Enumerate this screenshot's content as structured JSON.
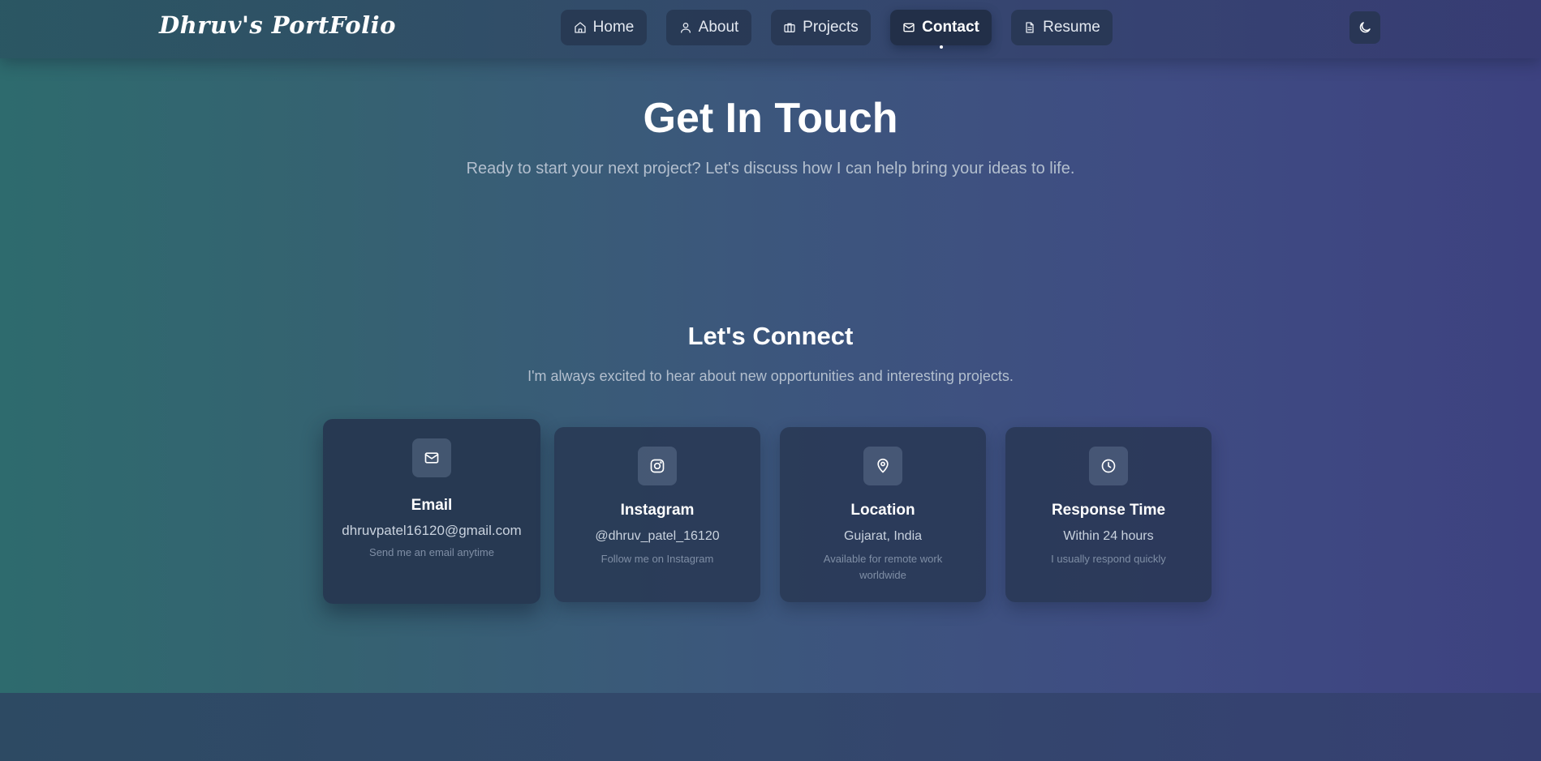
{
  "header": {
    "brand": "Dhruv's PortFolio",
    "nav": [
      {
        "label": "Home",
        "icon": "home-icon"
      },
      {
        "label": "About",
        "icon": "user-icon"
      },
      {
        "label": "Projects",
        "icon": "briefcase-icon"
      },
      {
        "label": "Contact",
        "icon": "mail-icon",
        "active": true
      },
      {
        "label": "Resume",
        "icon": "file-text-icon"
      }
    ],
    "theme_toggle_icon": "moon-icon"
  },
  "hero": {
    "title": "Get In Touch",
    "subtitle": "Ready to start your next project? Let's discuss how I can help bring your ideas to life."
  },
  "connect": {
    "title": "Let's Connect",
    "subtitle": "I'm always excited to hear about new opportunities and interesting projects.",
    "cards": [
      {
        "title": "Email",
        "value": "dhruvpatel16120@gmail.com",
        "note": "Send me an email anytime",
        "icon": "mail-icon"
      },
      {
        "title": "Instagram",
        "value": "@dhruv_patel_16120",
        "note": "Follow me on Instagram",
        "icon": "instagram-icon"
      },
      {
        "title": "Location",
        "value": "Gujarat, India",
        "note": "Available for remote work worldwide",
        "icon": "map-pin-icon"
      },
      {
        "title": "Response Time",
        "value": "Within 24 hours",
        "note": "I usually respond quickly",
        "icon": "clock-icon"
      }
    ]
  },
  "colors": {
    "gradient_left": "#2e6b6e",
    "gradient_right": "#3d4280",
    "card_bg": "#263450"
  }
}
